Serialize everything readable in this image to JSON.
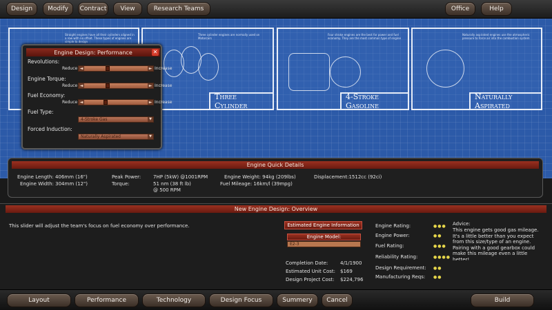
{
  "top_menu": {
    "design": "Design",
    "modify": "Modify",
    "contract": "Contract",
    "view": "View",
    "research_teams": "Research Teams",
    "office": "Office",
    "help": "Help"
  },
  "blueprint": {
    "panels": [
      {
        "caption": "Three Cylinder",
        "note": "Three cylinder engines are normally used on Motorcars"
      },
      {
        "caption": "4-Stroke Gasoline",
        "note": "Four stroke engines are the best for power and fuel economy. They are the most common type of engine"
      },
      {
        "caption": "Naturally Aspirated",
        "note": "Naturally aspirated engines use the atmospheric pressure to force air into the combustion system"
      }
    ],
    "left_note": "Straight engines have all their cylinders aligned in a row with no offset. These types of engines are simple to design"
  },
  "engine_dialog": {
    "title": "Engine Design: Performance",
    "close": "✕",
    "revolutions_label": "Revolutions:",
    "torque_label": "Engine Torque:",
    "fuel_economy_label": "Fuel Economy:",
    "fuel_type_label": "Fuel Type:",
    "forced_induction_label": "Forced Induction:",
    "reduce": "Reduce",
    "increase": "Increase",
    "revolutions_value": 0.35,
    "torque_value": 0.35,
    "fuel_economy_value": 0.32,
    "fuel_type_value": "4-Stroke Gas",
    "forced_induction_value": "Naturally Aspirated"
  },
  "quick_details": {
    "title": "Engine Quick Details",
    "length": "Engine Length: 406mm (16\")",
    "width": "Engine Width: 304mm (12\")",
    "peak_power_label": "Peak Power:",
    "peak_power_value": "7HP (5kW) @1001RPM",
    "torque_label": "Torque:",
    "torque_value": "51 nm (38 ft lb)",
    "torque_rpm": "@ 500 RPM",
    "weight": "Engine Weight: 94kg (209lbs)",
    "mileage": "Fuel Mileage: 16km/l (39mpg)",
    "displacement": "Displacement:1512cc (92ci)"
  },
  "overview": {
    "title": "New Engine Design: Overview",
    "hint": "This slider will adjust the team's focus on fuel economy over performance.",
    "estimated_info": "Estimated Engine Information",
    "engine_model_label": "Engine Model:",
    "engine_model_value": "E2-3",
    "completion_date_label": "Completion Date:",
    "completion_date_value": "4/1/1900",
    "unit_cost_label": "Estimated Unit Cost:",
    "unit_cost_value": "$169",
    "project_cost_label": "Design Project Cost:",
    "project_cost_value": "$224,796",
    "ratings": [
      {
        "label": "Engine Rating:",
        "dots": "●●●"
      },
      {
        "label": "Engine Power:",
        "dots": "●●"
      },
      {
        "label": "Fuel Rating:",
        "dots": "●●●"
      },
      {
        "label": "Reliability Rating:",
        "dots": "●●●●"
      },
      {
        "label": "Design Requirement:",
        "dots": "●●"
      },
      {
        "label": "Manufacturing Reqs:",
        "dots": "●●"
      }
    ],
    "advice_label": "Advice:",
    "advice_text": "This engine gets good gas mileage. It's a little better than you expect from this size/type of an engine. Pairing with a good gearbox could make this mileage even a little better!"
  },
  "bottom_tabs": {
    "layout": "Layout",
    "performance": "Performance",
    "technology": "Technology",
    "design_focus": "Design Focus",
    "summary": "Summery",
    "cancel": "Cancel",
    "build": "Build"
  }
}
